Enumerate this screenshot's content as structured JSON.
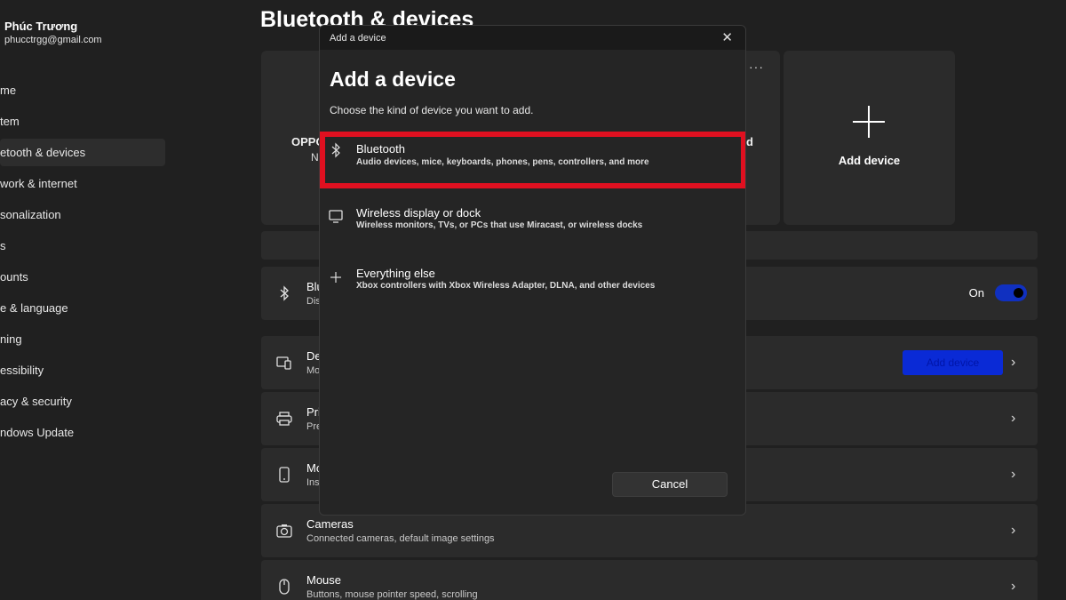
{
  "profile": {
    "name": "Phúc Trương",
    "email": "phucctrgg@gmail.com"
  },
  "sidebar": {
    "items": [
      {
        "label": "me"
      },
      {
        "label": "tem"
      },
      {
        "label": "etooth & devices"
      },
      {
        "label": "work & internet"
      },
      {
        "label": "sonalization"
      },
      {
        "label": "s"
      },
      {
        "label": "ounts"
      },
      {
        "label": "e & language"
      },
      {
        "label": "ning"
      },
      {
        "label": "essibility"
      },
      {
        "label": "acy & security"
      },
      {
        "label": "ndows Update"
      }
    ]
  },
  "page": {
    "title": "Bluetooth & devices",
    "device_card": {
      "label": "OPPO",
      "sub": "N",
      "more": "···",
      "right_label": "d"
    },
    "add_card": {
      "label": "Add device"
    },
    "rows": [
      {
        "title": "Blu",
        "sub": "Dis",
        "state": "On"
      },
      {
        "title": "De",
        "sub": "Mo",
        "button": "Add device"
      },
      {
        "title": "Pri",
        "sub": "Pre"
      },
      {
        "title": "Mo",
        "sub": "Ins"
      },
      {
        "title": "Cameras",
        "sub": "Connected cameras, default image settings"
      },
      {
        "title": "Mouse",
        "sub": "Buttons, mouse pointer speed, scrolling"
      }
    ]
  },
  "dialog": {
    "window_title": "Add a device",
    "close_glyph": "✕",
    "heading": "Add a device",
    "description": "Choose the kind of device you want to add.",
    "options": [
      {
        "title": "Bluetooth",
        "subtitle": "Audio devices, mice, keyboards, phones, pens, controllers, and more",
        "icon": "bluetooth-icon"
      },
      {
        "title": "Wireless display or dock",
        "subtitle": "Wireless monitors, TVs, or PCs that use Miracast, or wireless docks",
        "icon": "monitor-icon"
      },
      {
        "title": "Everything else",
        "subtitle": "Xbox controllers with Xbox Wireless Adapter, DLNA, and other devices",
        "icon": "plus-icon"
      }
    ],
    "cancel_label": "Cancel"
  },
  "colors": {
    "highlight": "#e01020",
    "accent": "#0a2ad6",
    "background": "#202020"
  }
}
